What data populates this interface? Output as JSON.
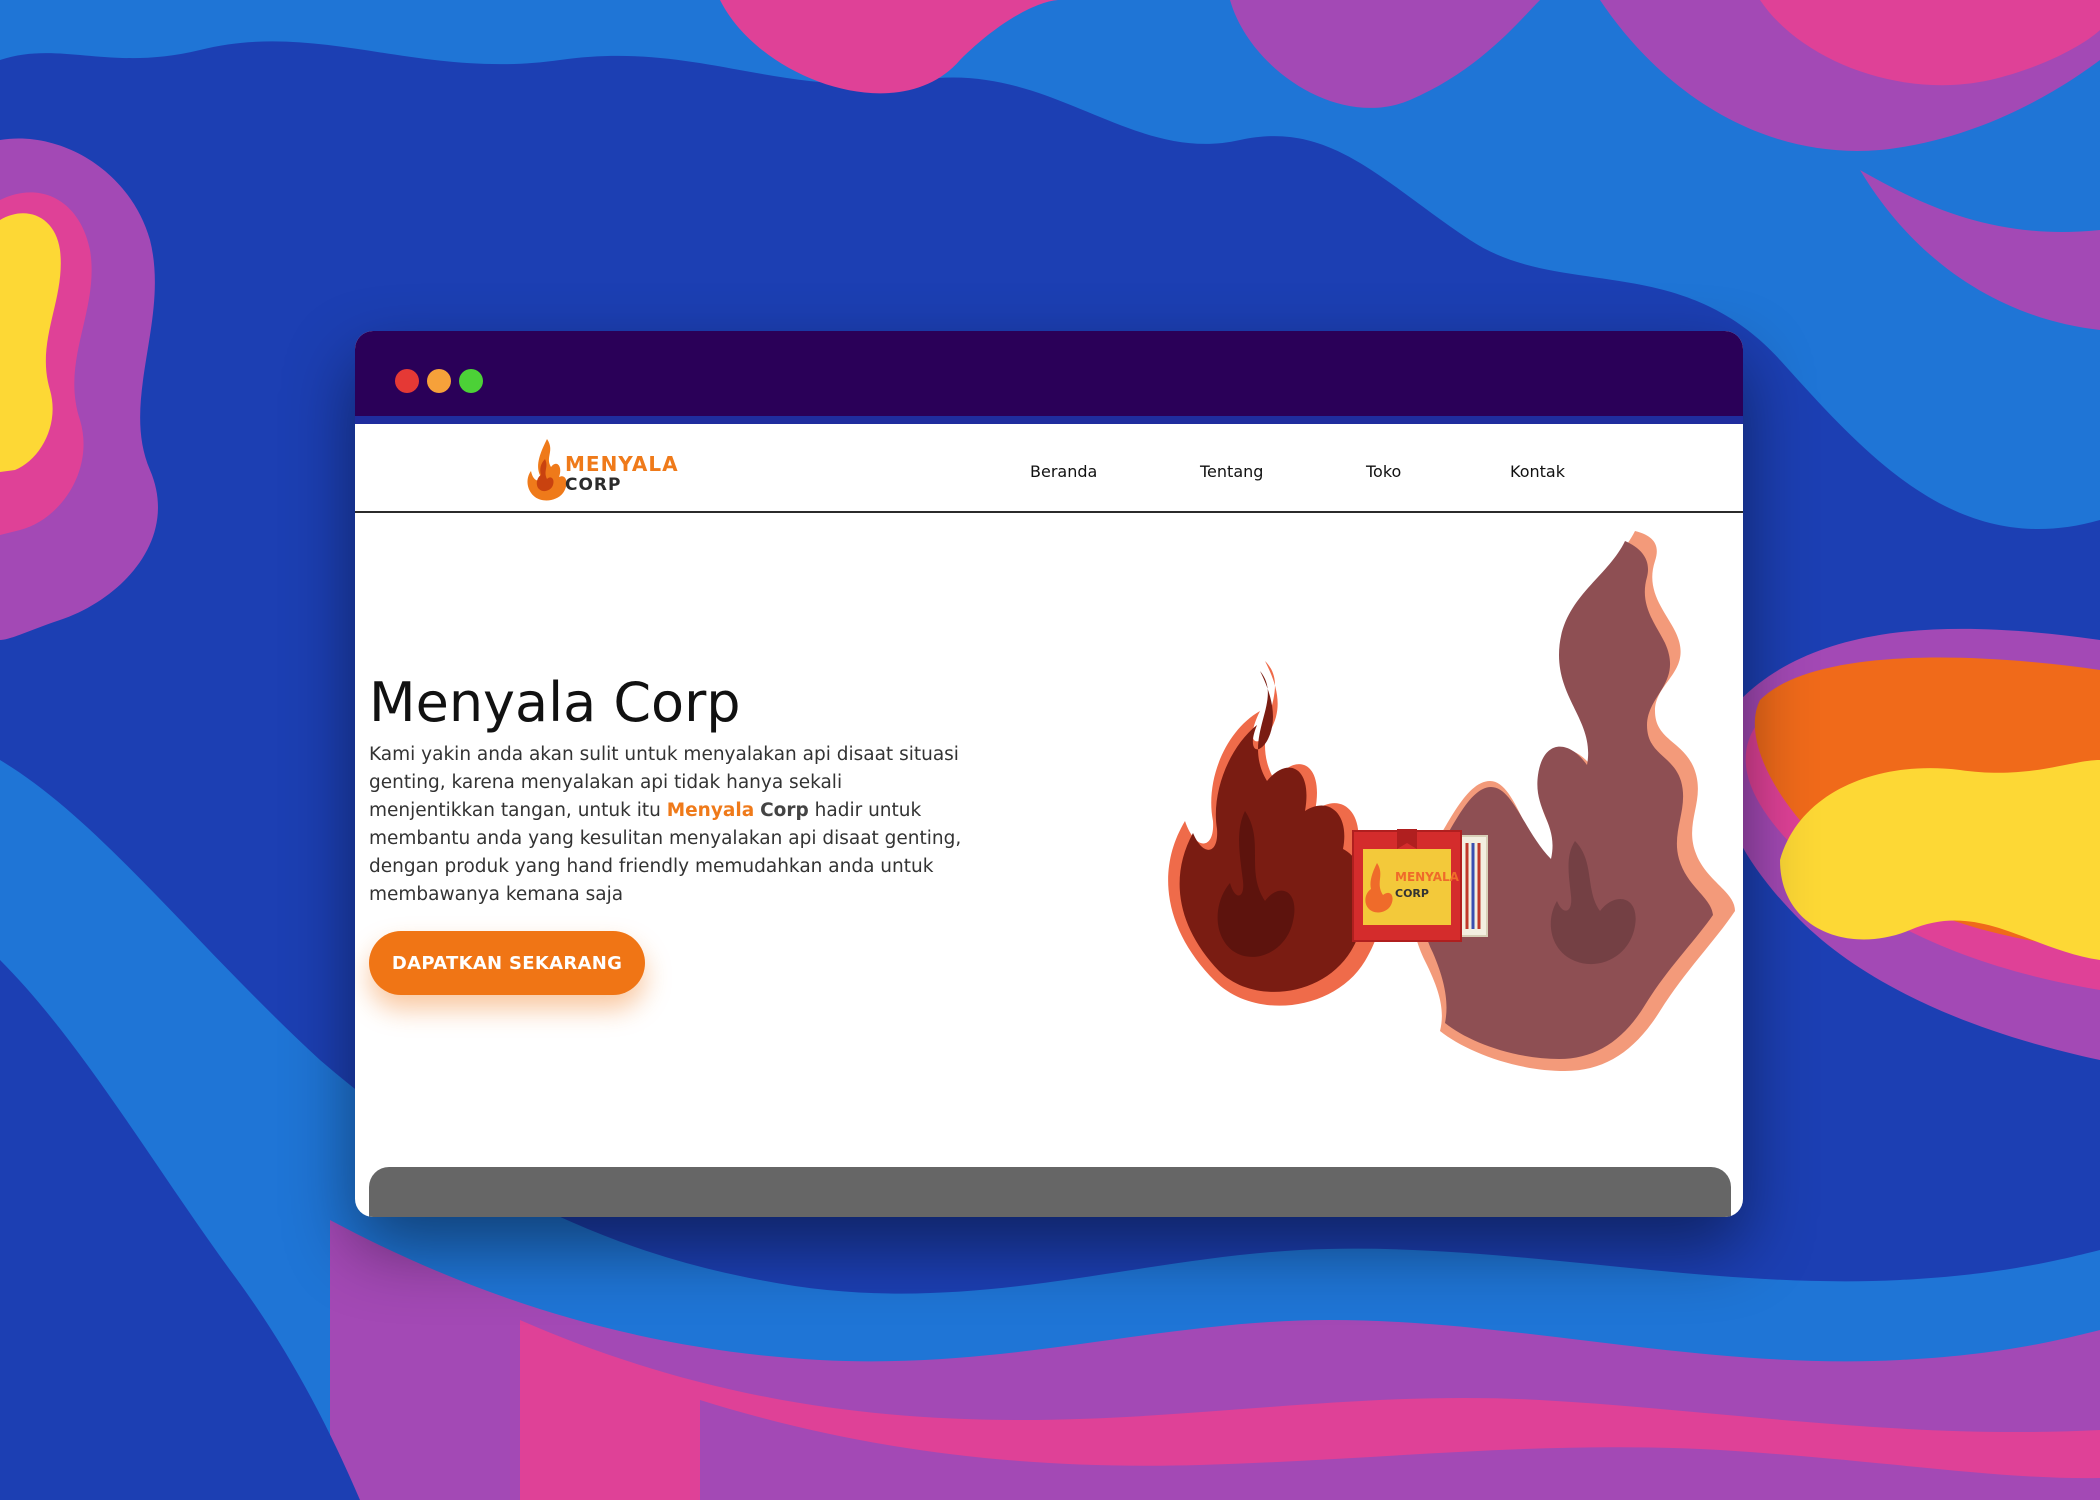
{
  "background": {
    "colors": [
      "#1c3fb3",
      "#1f75d6",
      "#a349b5",
      "#df4197",
      "#f06a1a",
      "#fdd835"
    ]
  },
  "browser": {
    "titlebar_color": "#2a0058",
    "accent_line_color": "#1f2d9e",
    "window_controls": [
      {
        "name": "close-dot",
        "color": "#e53935"
      },
      {
        "name": "minimize-dot",
        "color": "#f6a13a"
      },
      {
        "name": "maximize-dot",
        "color": "#4cd137"
      }
    ]
  },
  "site": {
    "logo": {
      "icon": "flame-icon",
      "line1": "MENYALA",
      "line2": "CORP"
    },
    "nav": [
      {
        "label": "Beranda"
      },
      {
        "label": "Tentang"
      },
      {
        "label": "Toko"
      },
      {
        "label": "Kontak"
      }
    ]
  },
  "hero": {
    "title": "Menyala Corp",
    "text_part1": "Kami yakin anda akan sulit untuk menyalakan api disaat situasi genting, karena menyalakan api tidak hanya sekali menjentikkan tangan, untuk itu ",
    "brand_orange": "Menyala",
    "brand_space": " ",
    "brand_dark": "Corp",
    "text_part2": " hadir untuk membantu anda yang kesulitan menyalakan api disaat genting, dengan produk yang hand friendly memudahkan anda untuk membawanya kemana saja",
    "cta_label": "DAPATKAN SEKARANG",
    "accent_color": "#f07515",
    "art": {
      "icons": [
        "flame-icon",
        "matchbox-icon"
      ],
      "matchbox_line1": "MENYALA",
      "matchbox_line2": "CORP"
    }
  },
  "footer_panel": {
    "color": "#666666"
  }
}
